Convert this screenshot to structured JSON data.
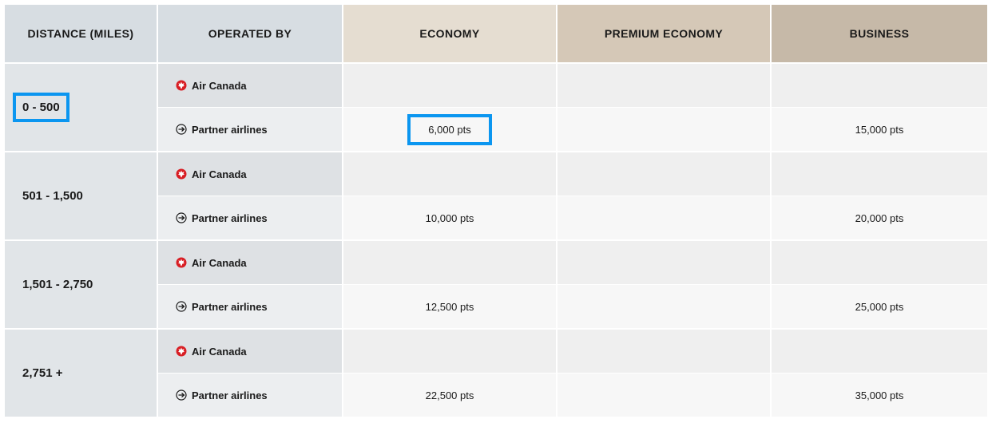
{
  "colors": {
    "highlight": "#0b96f0",
    "air_canada_red": "#d81e24"
  },
  "headers": {
    "distance": "DISTANCE (MILES)",
    "operated_by": "OPERATED BY",
    "economy": "ECONOMY",
    "premium_economy": "PREMIUM ECONOMY",
    "business": "BUSINESS"
  },
  "operators": {
    "air_canada": {
      "label": "Air Canada",
      "icon": "maple-leaf-icon"
    },
    "partner": {
      "label": "Partner airlines",
      "icon": "plane-circle-icon"
    }
  },
  "groups": [
    {
      "distance": "0 - 500",
      "highlighted": true,
      "air_canada": {
        "economy": "",
        "premium_economy": "",
        "business": ""
      },
      "partner": {
        "economy": "6,000 pts",
        "premium_economy": "",
        "business": "15,000 pts",
        "economy_highlighted": true
      }
    },
    {
      "distance": "501 - 1,500",
      "air_canada": {
        "economy": "",
        "premium_economy": "",
        "business": ""
      },
      "partner": {
        "economy": "10,000 pts",
        "premium_economy": "",
        "business": "20,000 pts"
      }
    },
    {
      "distance": "1,501 - 2,750",
      "air_canada": {
        "economy": "",
        "premium_economy": "",
        "business": ""
      },
      "partner": {
        "economy": "12,500 pts",
        "premium_economy": "",
        "business": "25,000 pts"
      }
    },
    {
      "distance": "2,751 +",
      "air_canada": {
        "economy": "",
        "premium_economy": "",
        "business": ""
      },
      "partner": {
        "economy": "22,500 pts",
        "premium_economy": "",
        "business": "35,000 pts"
      }
    }
  ]
}
